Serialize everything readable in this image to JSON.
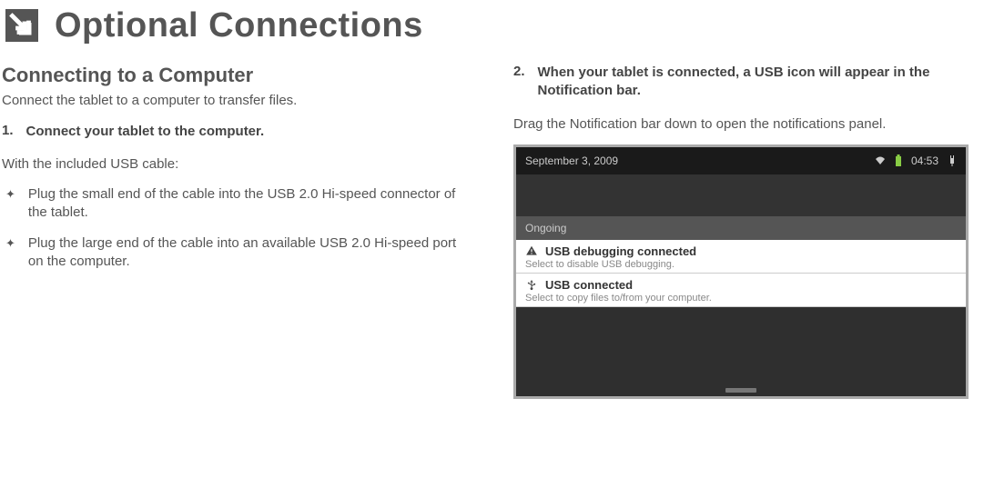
{
  "title": "Optional Connections",
  "left": {
    "subheading": "Connecting to a Computer",
    "intro": "Connect the tablet to a computer to transfer files.",
    "step1_num": "1.",
    "step1_text": "Connect your tablet to the computer.",
    "detail1": "With the included USB cable:",
    "bullet1": "Plug the small end of the cable into the USB 2.0 Hi-speed connector of the tablet.",
    "bullet2": "Plug the large end of the cable into an available USB 2.0 Hi-speed port on the computer."
  },
  "right": {
    "step2_num": "2.",
    "step2_text": "When your tablet is connected, a USB icon will appear in the Notification bar.",
    "detail2": "Drag the Notification bar down to open the notifications panel."
  },
  "screenshot": {
    "status_date": "September 3, 2009",
    "status_time": "04:53",
    "ongoing_label": "Ongoing",
    "notif1_title": "USB debugging connected",
    "notif1_sub": "Select to disable USB debugging.",
    "notif2_title": "USB connected",
    "notif2_sub": "Select to copy files to/from your computer."
  }
}
